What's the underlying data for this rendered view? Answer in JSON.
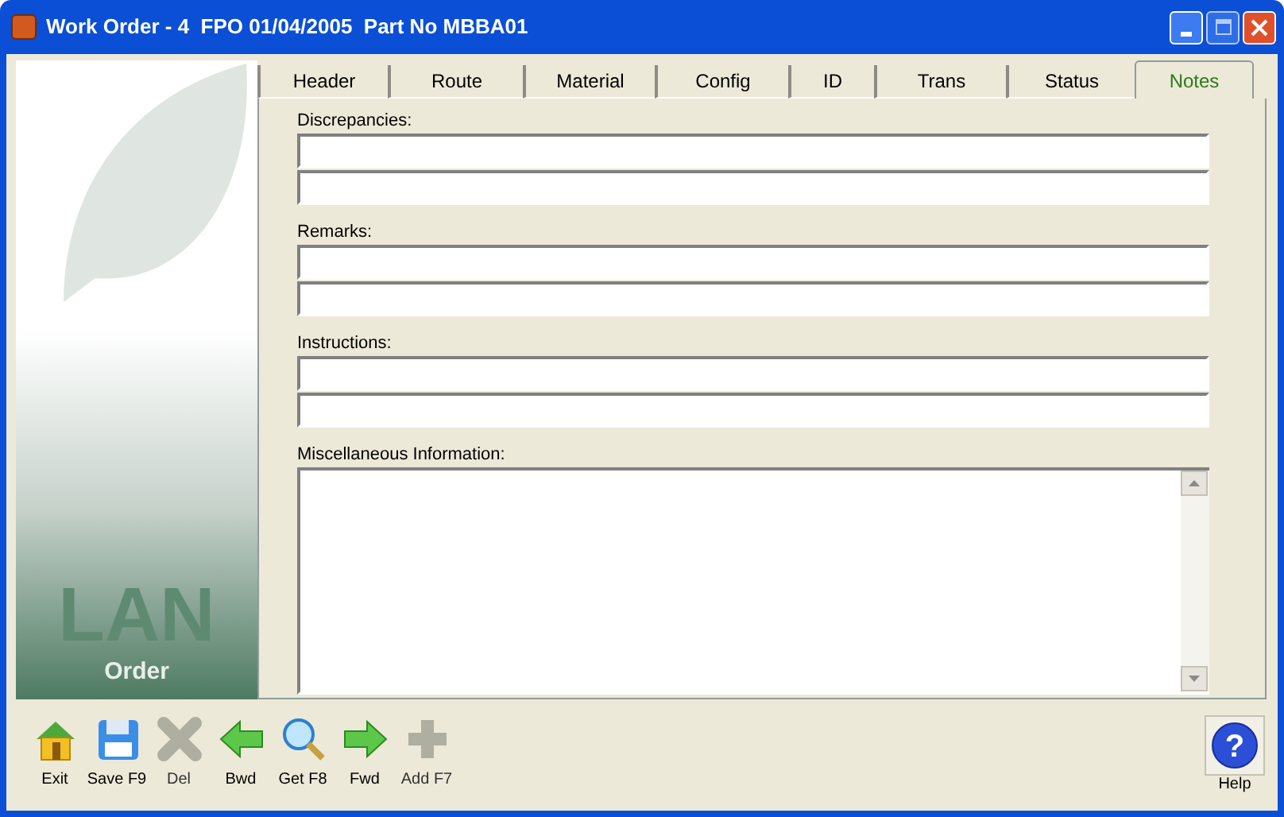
{
  "window": {
    "title": "Work Order - 4  FPO 01/04/2005  Part No MBBA01"
  },
  "logo": {
    "big_text": "LAN",
    "caption": "Order"
  },
  "tabs": [
    {
      "label": "Header",
      "selected": false
    },
    {
      "label": "Route",
      "selected": false
    },
    {
      "label": "Material",
      "selected": false
    },
    {
      "label": "Config",
      "selected": false
    },
    {
      "label": "ID",
      "selected": false
    },
    {
      "label": "Trans",
      "selected": false
    },
    {
      "label": "Status",
      "selected": false
    },
    {
      "label": "Notes",
      "selected": true
    }
  ],
  "sections": [
    {
      "label": "Discrepancies:",
      "kind": "lines"
    },
    {
      "label": "Remarks:",
      "kind": "lines"
    },
    {
      "label": "Instructions:",
      "kind": "lines"
    },
    {
      "label": "Miscellaneous Information:",
      "kind": "memo"
    }
  ],
  "toolbar": [
    {
      "label": "Exit",
      "kind": "exit",
      "disabled": false
    },
    {
      "label": "Save F9",
      "kind": "save",
      "disabled": false
    },
    {
      "label": "Del",
      "kind": "delete",
      "disabled": true
    },
    {
      "label": "Bwd",
      "kind": "back",
      "disabled": false
    },
    {
      "label": "Get F8",
      "kind": "find",
      "disabled": false
    },
    {
      "label": "Fwd",
      "kind": "forward",
      "disabled": false
    },
    {
      "label": "Add F7",
      "kind": "add",
      "disabled": true
    }
  ],
  "help": {
    "glyph": "?",
    "label": "Help"
  }
}
